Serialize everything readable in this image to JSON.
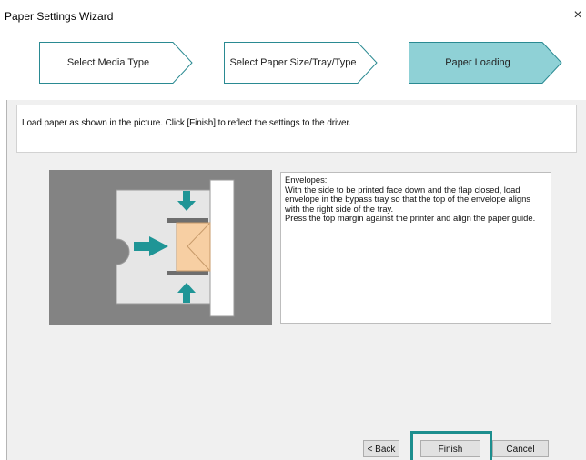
{
  "window": {
    "title": "Paper Settings Wizard",
    "close_glyph": "×",
    "close_icon": "close-icon"
  },
  "steps": [
    {
      "label": "Select Media Type",
      "active": false
    },
    {
      "label": "Select Paper Size/Tray/Type",
      "active": false
    },
    {
      "label": "Paper Loading",
      "active": true
    }
  ],
  "colors": {
    "step_inactive_bg": "#ffffff",
    "step_active_bg": "#8fd1d6",
    "step_border": "#2a8a92",
    "arrow_teal": "#1f9596",
    "envelope": "#f7cfa3",
    "highlight": "#1c8e8e"
  },
  "instruction": "Load paper as shown in the picture. Click [Finish] to reflect the settings to the driver.",
  "description": {
    "lines": [
      "Envelopes:",
      "With the side to be printed face down and the flap closed, load",
      "envelope in the bypass tray so that the top of the envelope aligns",
      "with the right side of the tray.",
      "Press the top margin against the printer and align the paper guide."
    ]
  },
  "buttons": {
    "back": "< Back",
    "finish": "Finish",
    "cancel": "Cancel"
  }
}
